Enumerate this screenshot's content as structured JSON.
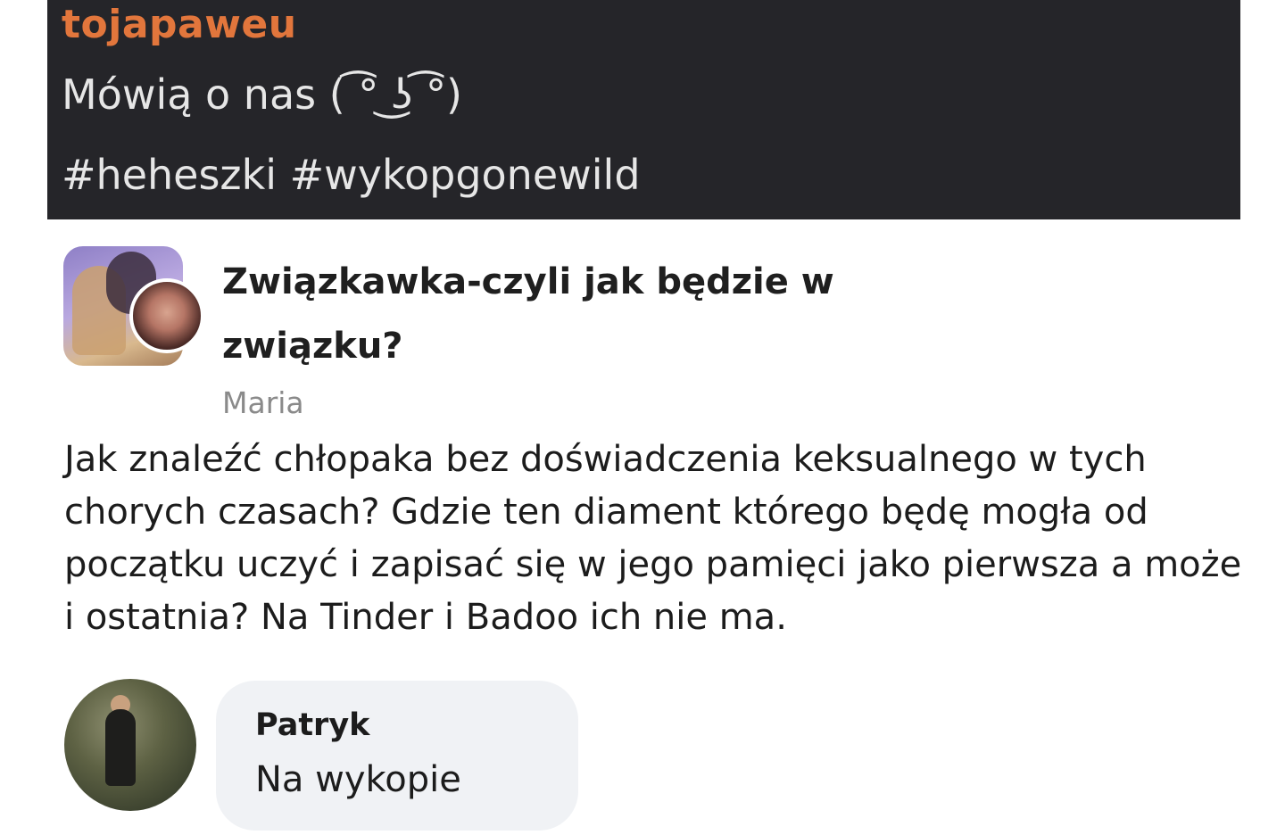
{
  "entry": {
    "author": "tojapaweu",
    "text": "Mówią o nas ( ͡° ͜ʖ ͡°)",
    "tags": [
      "#heheszki",
      "#wykopgonewild"
    ]
  },
  "post": {
    "group_title": "Związkawka-czyli jak będzie w związku?",
    "poster": "Maria",
    "body": "Jak znaleźć chłopaka bez doświadczenia keksualnego w tych chorych czasach? Gdzie ten diament którego będę mogła od początku uczyć i zapisać się w jego pamięci jako pierwsza a może i ostatnia? Na Tinder i Badoo ich nie ma."
  },
  "comment": {
    "author": "Patryk",
    "text": "Na wykopie"
  },
  "colors": {
    "header_bg": "#252529",
    "author_accent": "#e2763c",
    "bubble_bg": "#f0f2f5"
  }
}
